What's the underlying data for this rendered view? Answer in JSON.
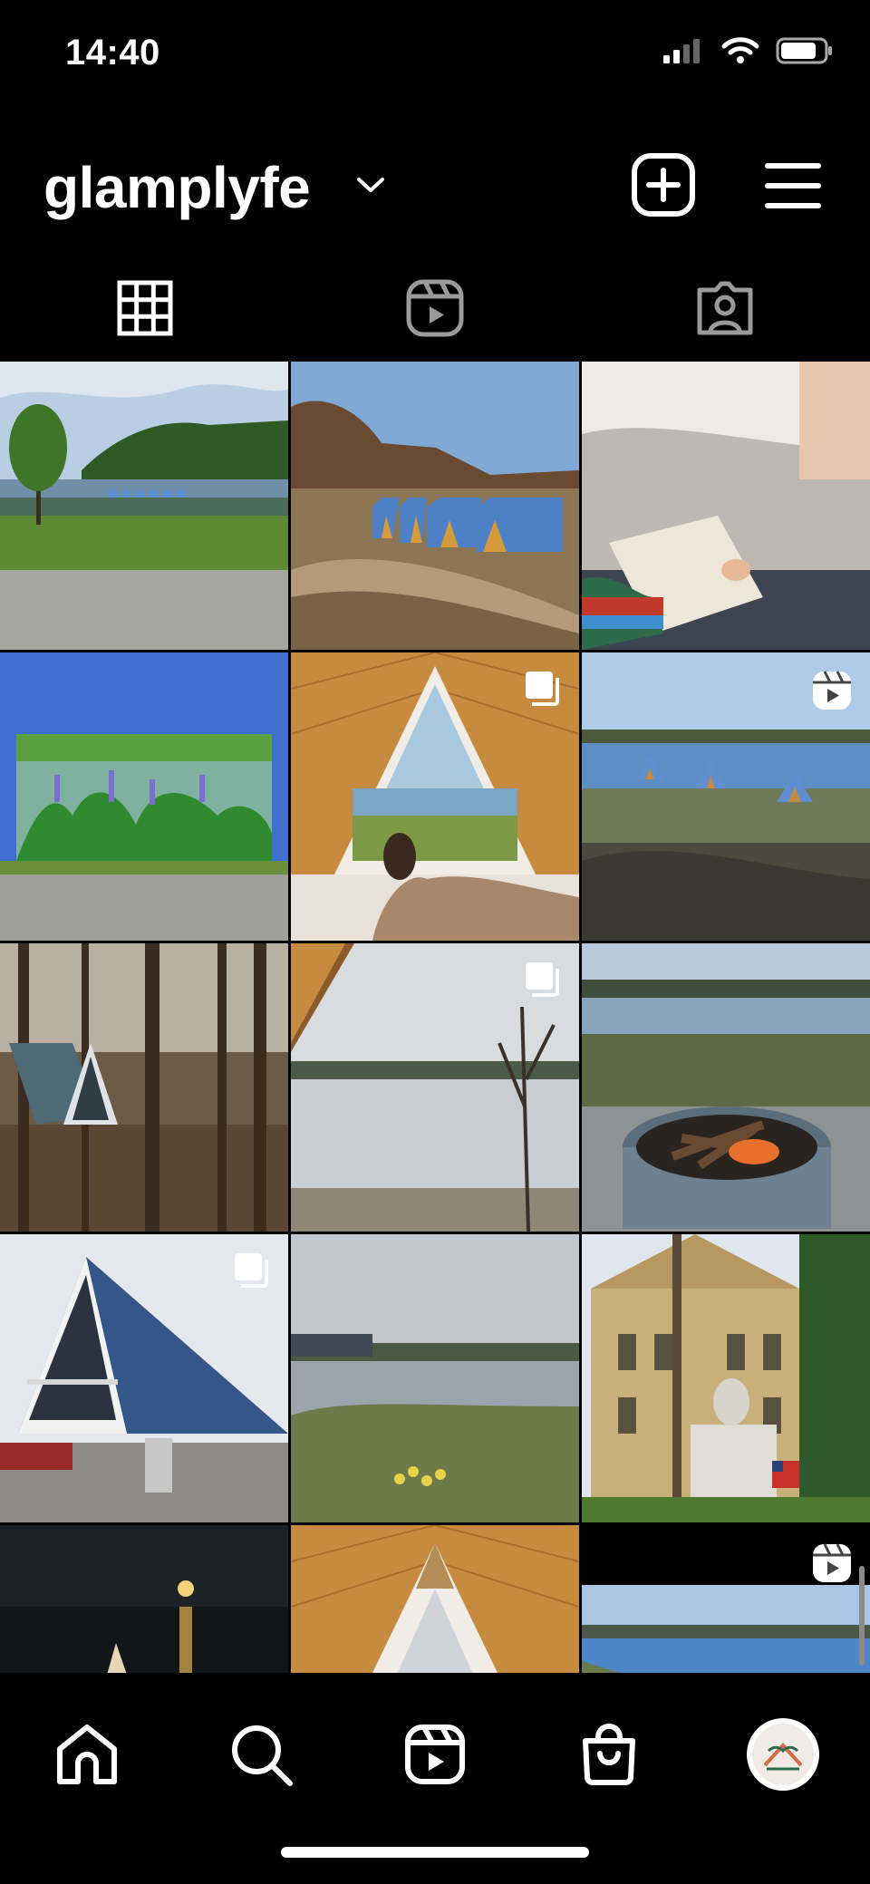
{
  "status_bar": {
    "time": "14:40"
  },
  "header": {
    "username": "glamplyfe"
  },
  "tabs": [
    {
      "icon": "grid-icon",
      "active": true
    },
    {
      "icon": "reels-icon",
      "active": false
    },
    {
      "icon": "tagged-icon",
      "active": false
    }
  ],
  "posts": [
    {
      "scene": "lake-with-tree",
      "badge": null
    },
    {
      "scene": "blue-a-frames-field",
      "badge": null
    },
    {
      "scene": "bed-journal",
      "badge": null
    },
    {
      "scene": "lake-flowers-inset",
      "badge": null
    },
    {
      "scene": "a-frame-window-interior",
      "badge": "carousel"
    },
    {
      "scene": "lake-a-frames",
      "badge": "reel"
    },
    {
      "scene": "woods-a-frame",
      "badge": null
    },
    {
      "scene": "lake-window-view",
      "badge": "carousel"
    },
    {
      "scene": "fire-pit",
      "badge": null
    },
    {
      "scene": "blue-a-frame-close",
      "badge": "carousel"
    },
    {
      "scene": "lake-daffodils",
      "badge": null
    },
    {
      "scene": "courthouse-monument",
      "badge": null
    },
    {
      "scene": "night-lake",
      "badge": null
    },
    {
      "scene": "a-frame-ceiling",
      "badge": null
    },
    {
      "scene": "lake-panorama",
      "badge": "reel"
    }
  ],
  "bottom_nav": [
    {
      "icon": "home-icon"
    },
    {
      "icon": "search-icon"
    },
    {
      "icon": "reels-icon"
    },
    {
      "icon": "shop-icon"
    },
    {
      "icon": "profile-avatar"
    }
  ],
  "colors": {
    "background": "#000000",
    "foreground": "#ffffff",
    "sky": "#5f8fd0",
    "grass": "#5d7f34",
    "a_frame_blue": "#4f7fc4",
    "wood": "#c58a3f"
  }
}
